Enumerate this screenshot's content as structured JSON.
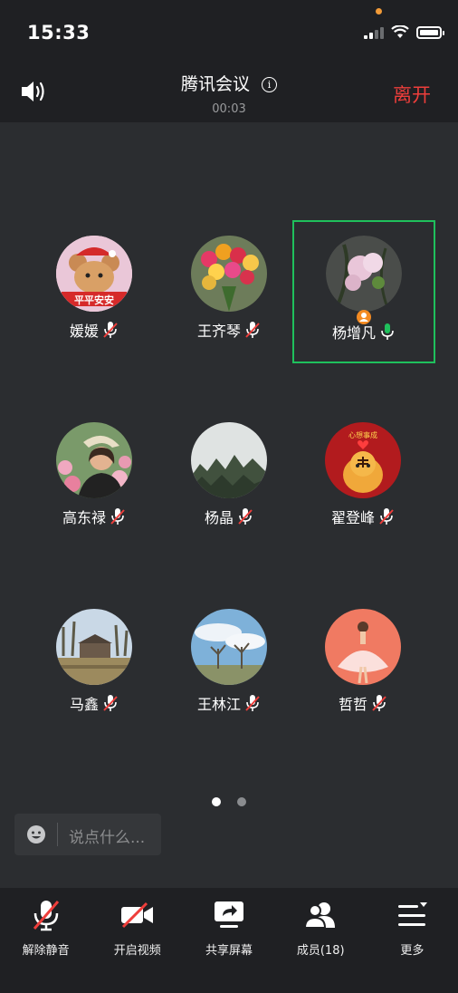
{
  "status_bar": {
    "time": "15:33"
  },
  "header": {
    "title": "腾讯会议",
    "duration": "00:03",
    "leave_label": "离开"
  },
  "participants": [
    {
      "name": "媛媛",
      "mic": "muted",
      "avatar_badge": "平平安安"
    },
    {
      "name": "王齐琴",
      "mic": "muted"
    },
    {
      "name": "杨增凡",
      "mic": "active",
      "host": true,
      "highlighted": true
    },
    {
      "name": "高东禄",
      "mic": "muted"
    },
    {
      "name": "杨晶",
      "mic": "muted"
    },
    {
      "name": "翟登峰",
      "mic": "muted",
      "avatar_badge": "心想事成"
    },
    {
      "name": "马鑫",
      "mic": "muted"
    },
    {
      "name": "王林江",
      "mic": "muted"
    },
    {
      "name": "哲哲",
      "mic": "muted"
    }
  ],
  "pager": {
    "current": 1,
    "total": 2
  },
  "chat": {
    "placeholder": "说点什么..."
  },
  "toolbar": {
    "unmute_label": "解除静音",
    "video_label": "开启视频",
    "share_label": "共享屏幕",
    "members_label": "成员(18)",
    "more_label": "更多"
  },
  "colors": {
    "leave": "#ee3e3b",
    "active_mic": "#1fc05c",
    "highlight_border": "#1fc05c",
    "background": "#2b2d30",
    "bar": "#1f2023"
  }
}
